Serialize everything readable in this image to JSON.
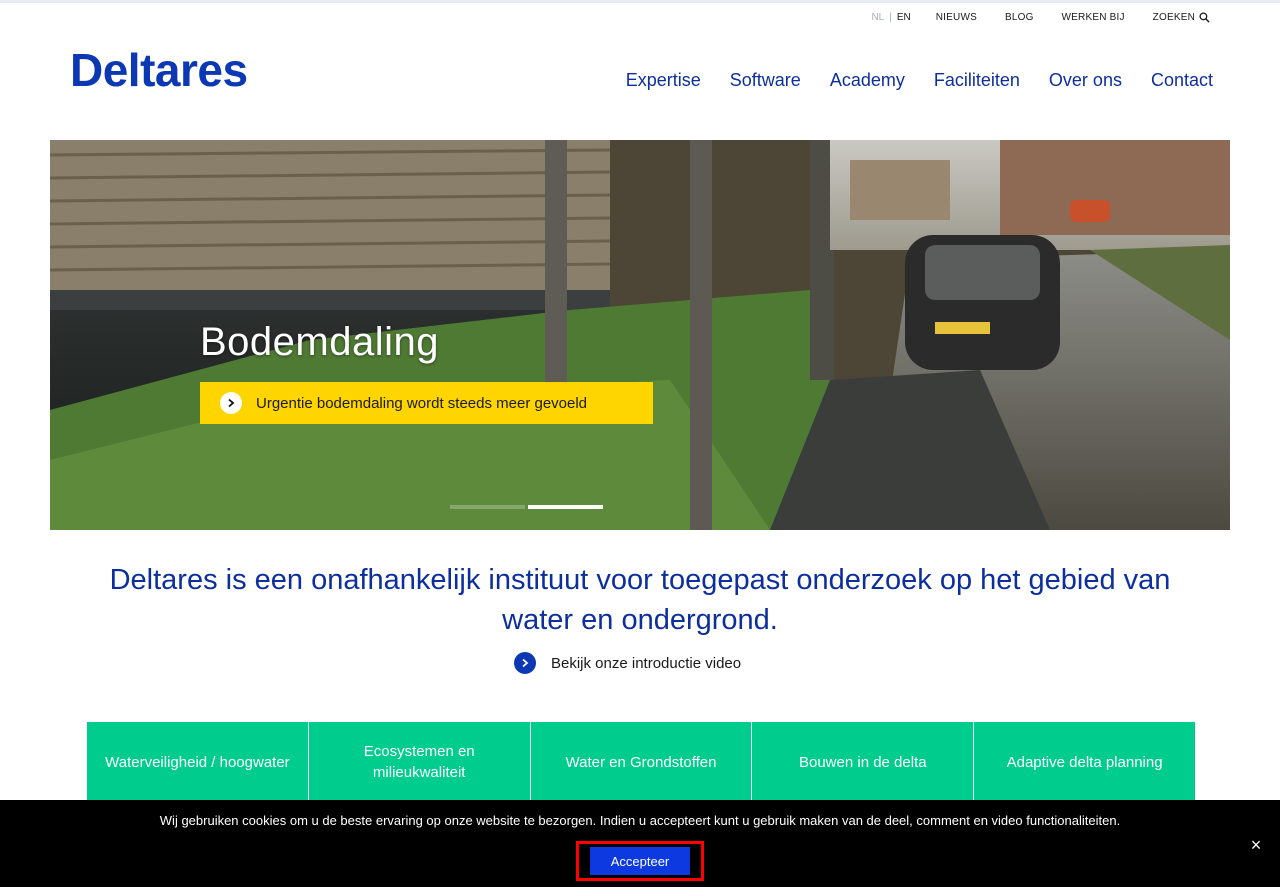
{
  "header": {
    "logo_text": "Deltares",
    "lang_nl": "NL",
    "lang_sep": "|",
    "lang_en": "EN",
    "utility_links": [
      "NIEUWS",
      "BLOG",
      "WERKEN BIJ"
    ],
    "search_label": "ZOEKEN"
  },
  "nav": {
    "items": [
      "Expertise",
      "Software",
      "Academy",
      "Faciliteiten",
      "Over ons",
      "Contact"
    ]
  },
  "hero": {
    "title": "Bodemdaling",
    "cta_label": "Urgentie bodemdaling wordt steeds meer gevoeld",
    "slides_total": 2,
    "active_slide": 2
  },
  "intro": {
    "tagline": "Deltares is een onafhankelijk instituut voor toegepast onderzoek op het gebied van water en ondergrond.",
    "video_link": "Bekijk onze introductie video"
  },
  "tiles": [
    "Waterveiligheid / hoogwater",
    "Ecosystemen en milieukwaliteit",
    "Water en Grondstoffen",
    "Bouwen in de delta",
    "Adaptive delta planning"
  ],
  "cookie": {
    "text": "Wij gebruiken cookies om u de beste ervaring op onze website te bezorgen. Indien u accepteert kunt u gebruik maken van de deel, comment en video functionaliteiten.",
    "accept_label": "Accepteer",
    "close_symbol": "×"
  },
  "colors": {
    "brand_blue": "#0d38b3",
    "nav_blue": "#0d2f9e",
    "cta_yellow": "#ffd500",
    "tile_green": "#00cc8e",
    "accept_blue": "#0d3ae0",
    "highlight_red": "#ff0000"
  }
}
